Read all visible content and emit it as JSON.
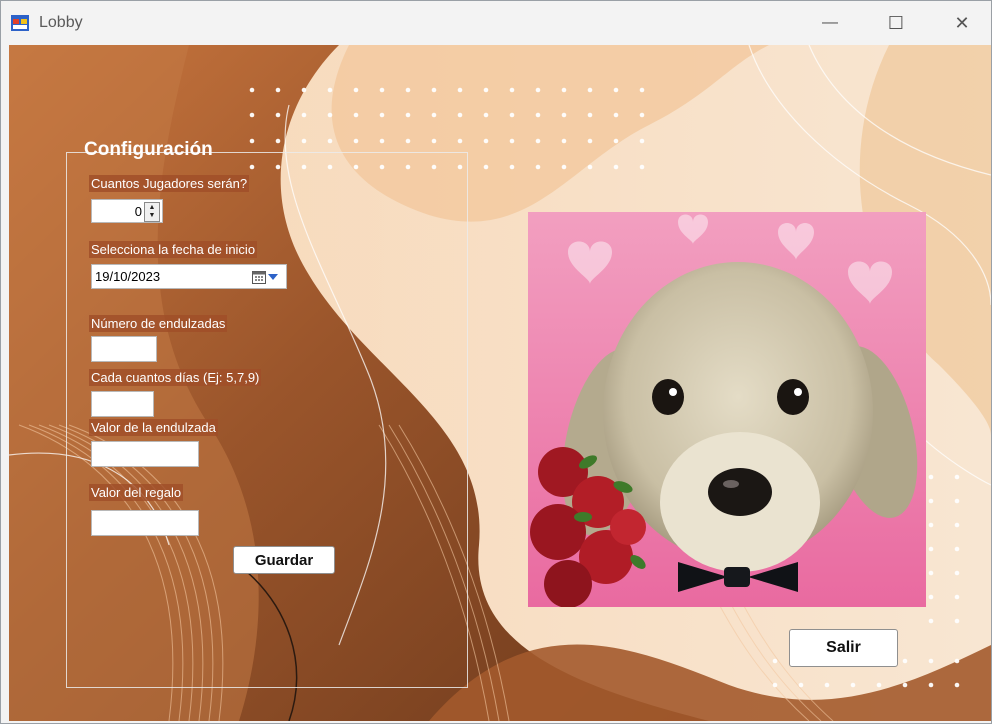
{
  "window": {
    "title": "Lobby",
    "controls": {
      "minimize": "—",
      "maximize": "☐",
      "close": "✕"
    }
  },
  "config": {
    "group_title": "Configuración",
    "players": {
      "label": "Cuantos Jugadores serán?",
      "value": "0"
    },
    "start_date": {
      "label": "Selecciona la fecha de inicio",
      "value": "19/10/2023"
    },
    "sweetenings": {
      "label": "Número de endulzadas",
      "value": ""
    },
    "every_days": {
      "label": "Cada cuantos días (Ej: 5,7,9)",
      "value": ""
    },
    "sweetening_value": {
      "label": "Valor de la endulzada",
      "value": ""
    },
    "gift_value": {
      "label": "Valor del regalo",
      "value": ""
    },
    "save_label": "Guardar"
  },
  "exit_label": "Salir",
  "colors": {
    "bg_brown": "#8a4a24",
    "bg_peach": "#f4dcc2",
    "label_bg": "#a04e28"
  }
}
